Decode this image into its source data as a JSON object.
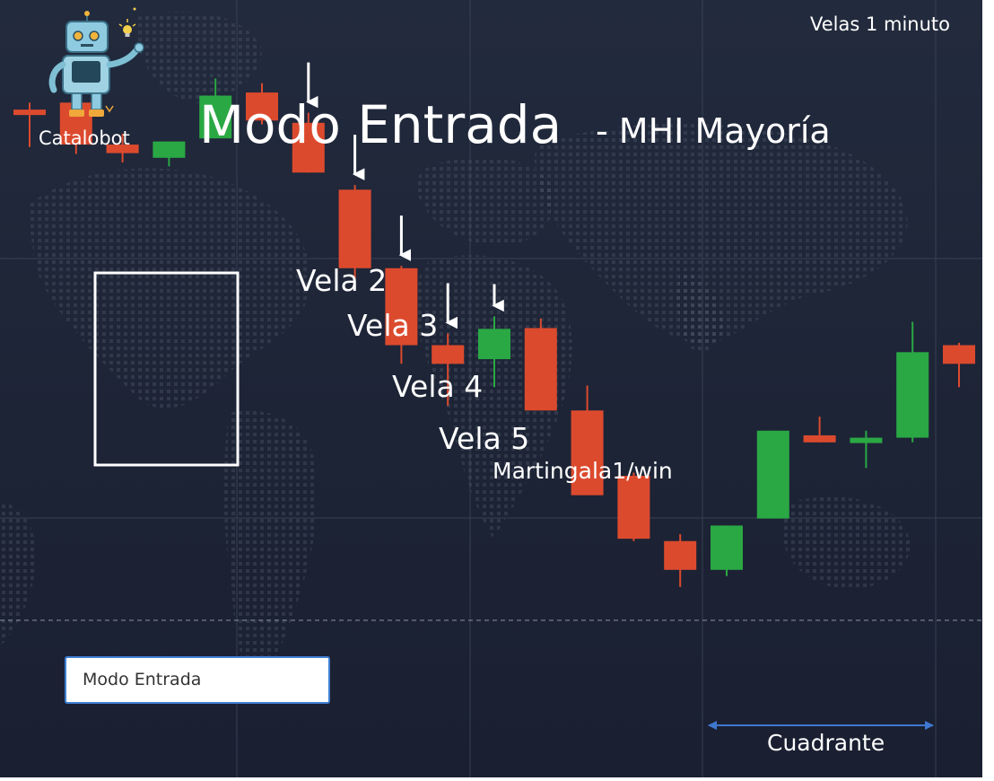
{
  "header": {
    "brand": "Catalobot",
    "title": "Modo Entrada",
    "subtitle": "- MHI Mayoría",
    "corner_note": "Velas 1 minuto"
  },
  "annotations": {
    "vela_2": "Vela 2",
    "vela_3": "Vela 3",
    "vela_4": "Vela 4",
    "vela_5": "Vela 5",
    "martingala": "Martingala1/win",
    "cuadrante": "Cuadrante"
  },
  "mode_field": {
    "value": "Modo Entrada"
  },
  "icons": {
    "logo": "robot-mascot-icon",
    "bulb": "lightbulb-icon"
  },
  "colors": {
    "bullish": "#2aa844",
    "bearish": "#dc4a2e",
    "background": "#1d2436",
    "highlight_box": "#ffffff",
    "range_arrow": "#3f78d0"
  },
  "chart_data": {
    "type": "candlestick",
    "timeframe": "1 minuto",
    "ylim": [
      0,
      100
    ],
    "grid": true,
    "axes_visible": false,
    "candles": [
      {
        "open": 85.9,
        "close": 85.9,
        "high": 86.8,
        "low": 81.1,
        "color": "bearish"
      },
      {
        "open": 86.8,
        "close": 81.4,
        "high": 87.4,
        "low": 80.2,
        "color": "bearish"
      },
      {
        "open": 81.4,
        "close": 80.3,
        "high": 82.8,
        "low": 79.1,
        "color": "bearish"
      },
      {
        "open": 79.7,
        "close": 81.8,
        "high": 81.8,
        "low": 78.6,
        "color": "bullish"
      },
      {
        "open": 82.2,
        "close": 87.7,
        "high": 89.9,
        "low": 82.2,
        "color": "bullish"
      },
      {
        "open": 88.1,
        "close": 84.5,
        "high": 89.3,
        "low": 84.0,
        "color": "bearish"
      },
      {
        "open": 84.2,
        "close": 77.8,
        "high": 85.5,
        "low": 77.8,
        "color": "bearish"
      },
      {
        "open": 75.6,
        "close": 65.5,
        "high": 76.2,
        "low": 63.8,
        "color": "bearish"
      },
      {
        "open": 65.5,
        "close": 55.6,
        "high": 65.8,
        "low": 53.2,
        "color": "bearish"
      },
      {
        "open": 55.6,
        "close": 53.2,
        "high": 57.1,
        "low": 47.8,
        "color": "bearish"
      },
      {
        "open": 53.8,
        "close": 57.7,
        "high": 59.3,
        "low": 50.2,
        "color": "bullish"
      },
      {
        "open": 57.8,
        "close": 47.2,
        "high": 59.0,
        "low": 47.2,
        "color": "bearish"
      },
      {
        "open": 47.2,
        "close": 36.3,
        "high": 50.4,
        "low": 36.3,
        "color": "bearish"
      },
      {
        "open": 38.8,
        "close": 30.7,
        "high": 39.2,
        "low": 30.4,
        "color": "bearish"
      },
      {
        "open": 30.4,
        "close": 26.7,
        "high": 31.3,
        "low": 24.5,
        "color": "bearish"
      },
      {
        "open": 26.7,
        "close": 32.4,
        "high": 32.4,
        "low": 25.9,
        "color": "bullish"
      },
      {
        "open": 33.3,
        "close": 44.6,
        "high": 44.6,
        "low": 33.3,
        "color": "bullish"
      },
      {
        "open": 44.0,
        "close": 43.1,
        "high": 46.4,
        "low": 43.1,
        "color": "bearish"
      },
      {
        "open": 43.1,
        "close": 43.7,
        "high": 44.6,
        "low": 39.8,
        "color": "bullish"
      },
      {
        "open": 43.7,
        "close": 54.7,
        "high": 58.6,
        "low": 43.1,
        "color": "bullish"
      },
      {
        "open": 55.6,
        "close": 53.2,
        "high": 55.9,
        "low": 50.2,
        "color": "bearish"
      }
    ],
    "highlighted_candles": [
      2,
      3,
      4
    ],
    "labeled_candles": [
      {
        "label": "Vela 2",
        "candle": 6
      },
      {
        "label": "Vela 3",
        "candle": 7
      },
      {
        "label": "Vela 4",
        "candle": 8
      },
      {
        "label": "Vela 5",
        "candle": 9
      },
      {
        "label": "Martingala1/win",
        "candle": 10
      }
    ],
    "range_arrow": {
      "label": "Cuadrante",
      "from_candle": 15,
      "to_candle": 19
    }
  }
}
